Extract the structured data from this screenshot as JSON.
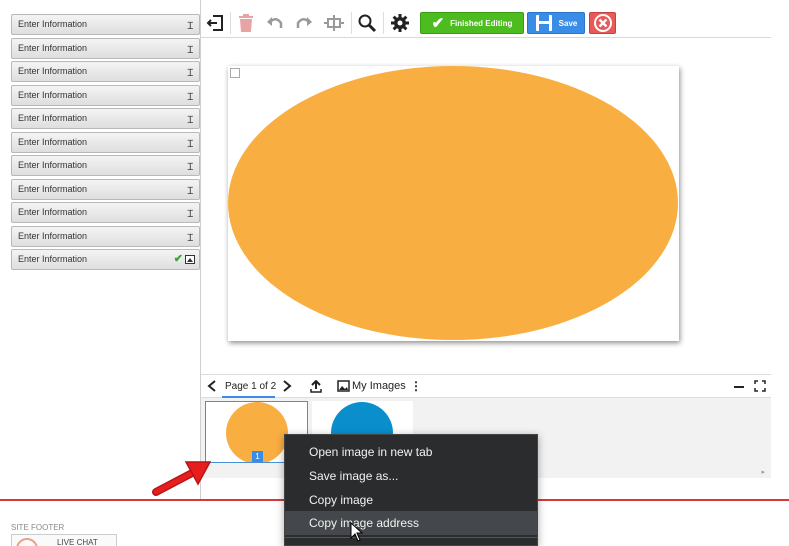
{
  "sidebar": {
    "fields": [
      {
        "label": "Enter Information",
        "icon": "text-cursor-icon"
      },
      {
        "label": "Enter Information",
        "icon": "text-cursor-icon"
      },
      {
        "label": "Enter Information",
        "icon": "text-cursor-icon"
      },
      {
        "label": "Enter Information",
        "icon": "text-cursor-icon"
      },
      {
        "label": "Enter Information",
        "icon": "text-cursor-icon"
      },
      {
        "label": "Enter Information",
        "icon": "text-cursor-icon"
      },
      {
        "label": "Enter Information",
        "icon": "text-cursor-icon"
      },
      {
        "label": "Enter Information",
        "icon": "text-cursor-icon"
      },
      {
        "label": "Enter Information",
        "icon": "text-cursor-icon"
      },
      {
        "label": "Enter Information",
        "icon": "text-cursor-icon"
      },
      {
        "label": "Enter Information",
        "icon": "image-icon"
      }
    ]
  },
  "toolbar": {
    "finished_label": "Finished Editing",
    "save_label": "Save"
  },
  "canvas": {
    "shape": "ellipse",
    "fill_color": "#f9ae42"
  },
  "image_panel": {
    "page_label": "Page 1 of 2",
    "my_images_label": "My Images",
    "thumbnails": [
      {
        "badge": "1",
        "color": "#f9ae42"
      },
      {
        "color": "#0a8fcc"
      }
    ]
  },
  "context_menu": {
    "items": [
      {
        "label": "Open image in new tab"
      },
      {
        "label": "Save image as..."
      },
      {
        "label": "Copy image"
      },
      {
        "label": "Copy image address"
      }
    ],
    "highlighted": "Copy image address"
  },
  "footer": {
    "label": "SITE FOOTER",
    "live_chat": "LIVE CHAT"
  },
  "colors": {
    "accent_red": "#d43a3a",
    "finished_green": "#4cbc1e",
    "save_blue": "#3a8de6"
  }
}
